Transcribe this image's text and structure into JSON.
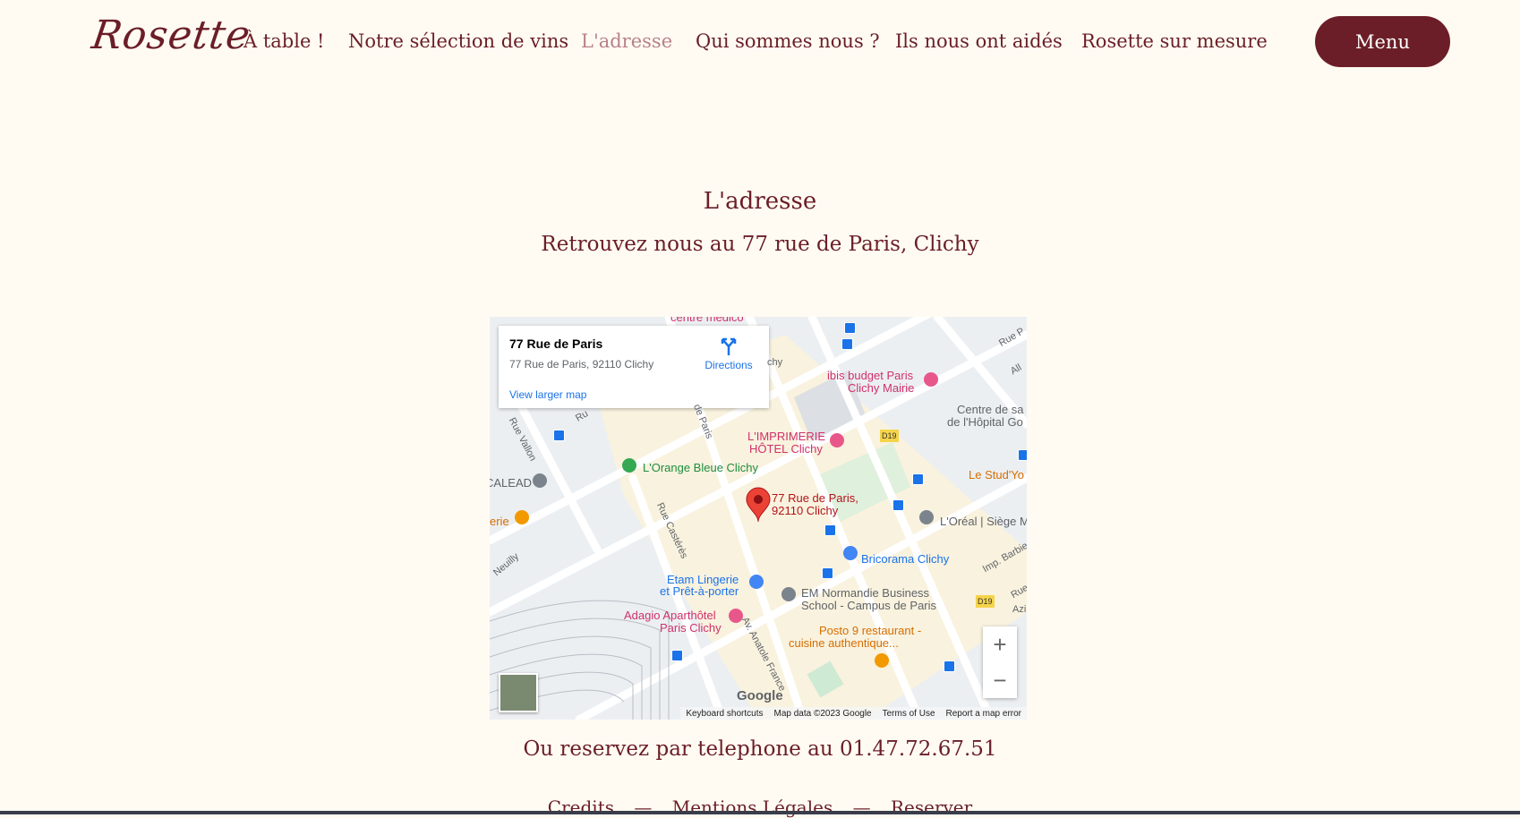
{
  "nav": {
    "logo": "Rosette",
    "items": [
      "À table !",
      "Notre sélection de vins",
      "L'adresse",
      "Qui sommes nous ?",
      "Ils nous ont aidés",
      "Rosette sur mesure"
    ],
    "menu_label": "Menu"
  },
  "main": {
    "title": "L'adresse",
    "subtitle": "Retrouvez nous au 77 rue de Paris, Clichy",
    "phone_text": "Ou reservez par telephone au 01.47.72.67.51"
  },
  "map": {
    "card_title": "77 Rue de Paris",
    "card_address": "77 Rue de Paris, 92110 Clichy",
    "directions_label": "Directions",
    "larger_map_label": "View larger map",
    "pin_label_1": "77 Rue de Paris,",
    "pin_label_2": "92110 Clichy",
    "places": {
      "ibis1": "ibis budget Paris",
      "ibis2": "Clichy Mairie",
      "imprimerie1": "L'IMPRIMERIE",
      "imprimerie2": "HÔTEL Clichy",
      "orange": "L'Orange Bleue Clichy",
      "centre1": "Centre de sa",
      "centre2": "de l'Hôpital Go",
      "studyo": "Le Stud'Yo",
      "oreal": "L'Oréal | Siège M",
      "bricorama": "Bricorama Clichy",
      "etam1": "Etam Lingerie",
      "etam2": "et Prêt-à-porter",
      "em1": "EM Normandie Business",
      "em2": "School - Campus de Paris",
      "adagio1": "Adagio Aparthôtel",
      "adagio2": "Paris Clichy",
      "posto1": "Posto 9 restaurant -",
      "posto2": "cuisine authentique...",
      "calead": "CALEAD",
      "gerie": "erie",
      "centre_m": "centre médico"
    },
    "streets": {
      "vallon": "Rue Vallon",
      "casteres": "Rue Castérès",
      "paris": "de Paris",
      "anatole": "Av. Anatole France",
      "neuilly": "Neuilly",
      "ruep": "Rue P",
      "all": "All",
      "barbie": "Imp. Barbie",
      "rue_r": "Rue",
      "azi": "Azi",
      "chy": "chy",
      "ru": "Ru"
    },
    "road_badges": [
      "D19",
      "D19"
    ],
    "zoom_in": "+",
    "zoom_out": "−",
    "google": "Google",
    "attribution": [
      "Keyboard shortcuts",
      "Map data ©2023 Google",
      "Terms of Use",
      "Report a map error"
    ]
  },
  "footer": {
    "links": [
      "Credits",
      "Mentions Légales",
      "Reserver"
    ],
    "separator": "—"
  },
  "colors": {
    "brand": "#6b1e27",
    "background": "#fffbf3",
    "active_nav": "#b98189"
  }
}
